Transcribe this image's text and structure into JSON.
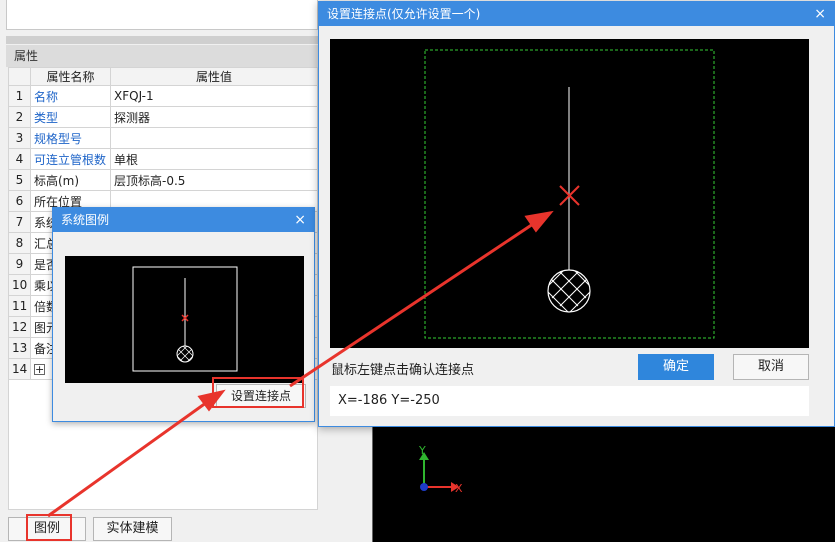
{
  "properties": {
    "panel_title": "属性",
    "col_name": "属性名称",
    "col_value": "属性值",
    "rows": [
      {
        "num": "1",
        "name": "名称",
        "value": "XFQJ-1"
      },
      {
        "num": "2",
        "name": "类型",
        "value": "探测器"
      },
      {
        "num": "3",
        "name": "规格型号",
        "value": ""
      },
      {
        "num": "4",
        "name": "可连立管根数",
        "value": "单根"
      },
      {
        "num": "5",
        "name": "标高(m)",
        "value": "层顶标高-0.5"
      },
      {
        "num": "6",
        "name": "所在位置",
        "value": ""
      },
      {
        "num": "7",
        "name": "系统",
        "value": ""
      },
      {
        "num": "8",
        "name": "汇总",
        "value": ""
      },
      {
        "num": "9",
        "name": "是否",
        "value": ""
      },
      {
        "num": "10",
        "name": "乘以",
        "value": ""
      },
      {
        "num": "11",
        "name": "倍数",
        "value": ""
      },
      {
        "num": "12",
        "name": "图元",
        "value": ""
      },
      {
        "num": "13",
        "name": "备注",
        "value": ""
      },
      {
        "num": "14",
        "name": "+",
        "value": ""
      }
    ]
  },
  "bottom_buttons": {
    "legend": "图例",
    "solid_model": "实体建模"
  },
  "system_legend_dialog": {
    "title": "系统图例",
    "close": "×",
    "set_point_button": "设置连接点"
  },
  "connection_dialog": {
    "title": "设置连接点(仅允许设置一个)",
    "close": "×",
    "hint": "鼠标左键点击确认连接点",
    "ok": "确定",
    "cancel": "取消",
    "coords": "X=-186  Y=-250"
  },
  "axes": {
    "y_label": "Y",
    "x_label": "X"
  },
  "colors": {
    "accent": "#3d8be0",
    "annotation": "#e8342c",
    "axis_x": "#e8342c",
    "axis_y": "#2fb52f",
    "frame": "#33cc33"
  }
}
